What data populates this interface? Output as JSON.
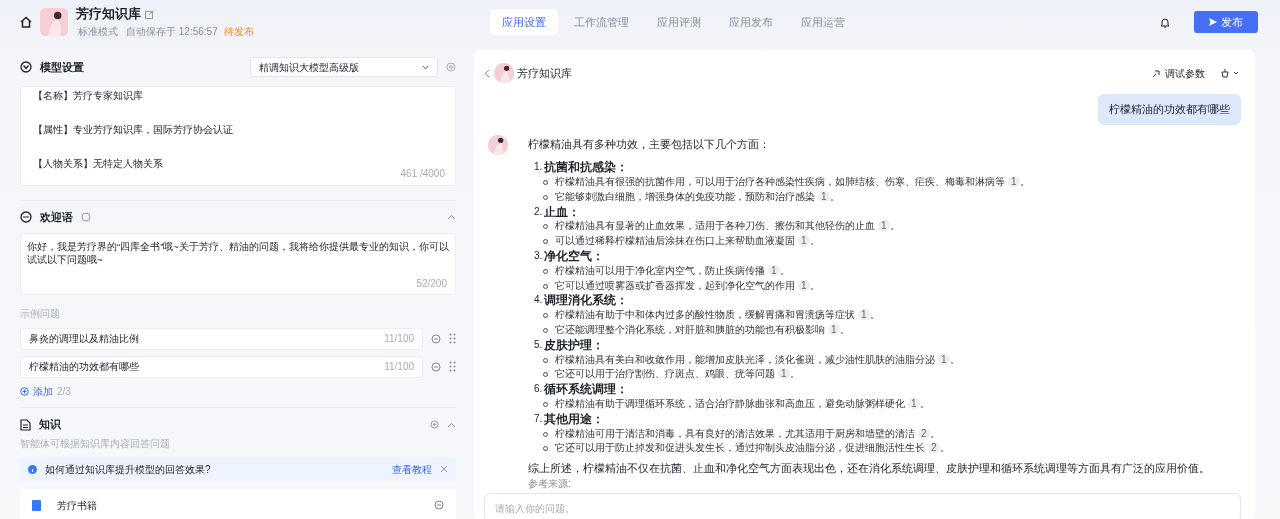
{
  "header": {
    "app_name": "芳疗知识库",
    "mode": "标准模式",
    "autosave": "自动保存于 12:56:57",
    "status": "待发布"
  },
  "tabs": [
    {
      "label": "应用设置",
      "selected": true
    },
    {
      "label": "工作流管理",
      "selected": false
    },
    {
      "label": "应用评测",
      "selected": false
    },
    {
      "label": "应用发布",
      "selected": false
    },
    {
      "label": "应用运营",
      "selected": false
    }
  ],
  "publish_button": "发布",
  "model_settings": {
    "title": "模型设置",
    "model": "精调知识大模型高级版",
    "prompt_lines": [
      "【名称】芳疗专家知识库",
      "【属性】专业芳疗知识库，国际芳疗协会认证",
      "【人物关系】无特定人物关系"
    ],
    "counter": "461 /4000"
  },
  "welcome": {
    "title": "欢迎语",
    "text": "你好，我是芳疗界的“四库全书”哦~关于芳疗、精油的问题，我将给你提供最专业的知识，你可以试试以下问题哦~",
    "counter": "52/200"
  },
  "example_questions": {
    "label": "示例问题",
    "items": [
      {
        "text": "鼻炎的调理以及精油比例",
        "counter": "11/100"
      },
      {
        "text": "柠檬精油的功效都有哪些",
        "counter": "11/100"
      }
    ],
    "add": "添加",
    "count": "2/3"
  },
  "knowledge": {
    "title": "知识",
    "description": "智能体可根据知识库内容回答问题",
    "tip": "如何通过知识库提升模型的回答效果?",
    "tip_link": "查看教程",
    "items": [
      {
        "name": "芳疗书籍"
      }
    ]
  },
  "chat": {
    "title": "芳疗知识库",
    "debug": "调试参数",
    "user_message": "柠檬精油的功效都有哪些",
    "intro": "柠檬精油具有多种功效，主要包括以下几个方面：",
    "sections": [
      {
        "number": "1.",
        "title": "抗菌和抗感染：",
        "bullets": [
          {
            "text": "柠檬精油具有很强的抗菌作用，可以用于治疗各种感染性疾病，如肺结核、伤寒、疟疾、梅毒和淋病等",
            "cite": "1",
            "end": "。"
          },
          {
            "text": "它能够刺激白细胞，增强身体的免疫功能，预防和治疗感染",
            "cite": "1",
            "end": "。"
          }
        ]
      },
      {
        "number": "2.",
        "title": "止血：",
        "bullets": [
          {
            "text": "柠檬精油具有显著的止血效果，适用于各种刀伤、擦伤和其他轻伤的止血",
            "cite": "1",
            "end": "。"
          },
          {
            "text": "可以通过稀释柠檬精油后涂抹在伤口上来帮助血液凝固",
            "cite": "1",
            "end": "。"
          }
        ]
      },
      {
        "number": "3.",
        "title": "净化空气：",
        "bullets": [
          {
            "text": "柠檬精油可以用于净化室内空气，防止疾病传播",
            "cite": "1",
            "end": "。"
          },
          {
            "text": "它可以通过喷雾器或扩香器挥发，起到净化空气的作用",
            "cite": "1",
            "end": "。"
          }
        ]
      },
      {
        "number": "4.",
        "title": "调理消化系统：",
        "bullets": [
          {
            "text": "柠檬精油有助于中和体内过多的酸性物质，缓解胃痛和胃溃疡等症状",
            "cite": "1",
            "end": "。"
          },
          {
            "text": "它还能调理整个消化系统，对肝脏和胰脏的功能也有积极影响",
            "cite": "1",
            "end": "。"
          }
        ]
      },
      {
        "number": "5.",
        "title": "皮肤护理：",
        "bullets": [
          {
            "text": "柠檬精油具有美白和收敛作用，能增加皮肤光泽，淡化雀斑，减少油性肌肤的油脂分泌",
            "cite": "1",
            "end": "。"
          },
          {
            "text": "它还可以用于治疗割伤、疗斑点、鸡眼、疣等问题",
            "cite": "1",
            "end": "。"
          }
        ]
      },
      {
        "number": "6.",
        "title": "循环系统调理：",
        "bullets": [
          {
            "text": "柠檬精油有助于调理循环系统，适合治疗静脉曲张和高血压，避免动脉粥样硬化",
            "cite": "1",
            "end": "。"
          }
        ]
      },
      {
        "number": "7.",
        "title": "其他用途：",
        "bullets": [
          {
            "text": "柠檬精油可用于清洁和消毒，具有良好的清洁效果，尤其适用于厨房和墙壁的清洁",
            "cite": "2",
            "end": "。"
          },
          {
            "text": "它还可以用于防止掉发和促进头发生长，通过抑制头皮油脂分泌，促进细胞活性生长",
            "cite": "2",
            "end": "。"
          }
        ]
      }
    ],
    "summary": "综上所述，柠檬精油不仅在抗菌、止血和净化空气方面表现出色，还在消化系统调理、皮肤护理和循环系统调理等方面具有广泛的应用价值。",
    "references_label": "参考来源:",
    "input_placeholder": "请输入你的问题。"
  }
}
